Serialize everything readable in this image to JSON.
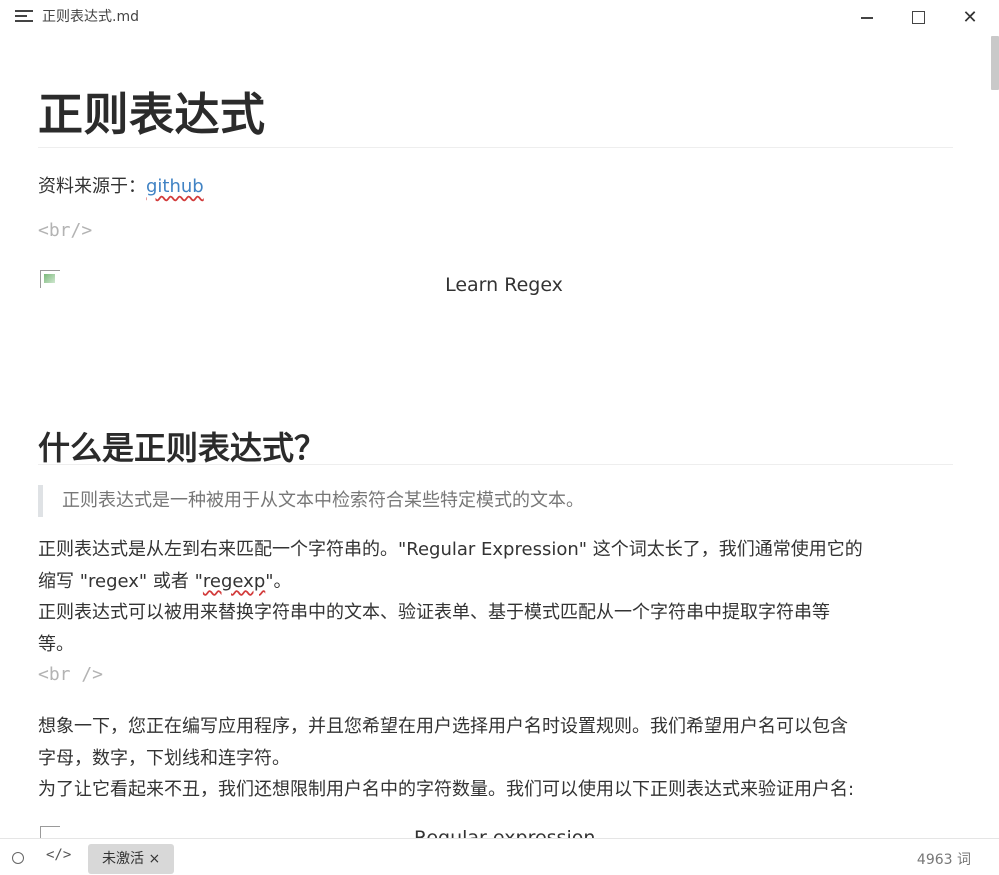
{
  "window": {
    "title": "正则表达式.md",
    "menu_icon": "hamburger-menu-icon",
    "minimize_icon": "minimize-icon",
    "maximize_icon": "maximize-icon",
    "close_glyph": "✕"
  },
  "document": {
    "h1": "正则表达式",
    "source_prefix": "资料来源于：",
    "source_link": "github",
    "br_code_1": "<br/>",
    "image_alt": "Learn Regex",
    "h2": "什么是正则表达式？",
    "blockquote": "正则表达式是一种被用于从文本中检索符合某些特定模式的文本。",
    "p1_line1": "正则表达式是从左到右来匹配一个字符串的。\"Regular Expression\" 这个词太长了，我们通常使用它的",
    "p1_line2_a": "缩写 \"regex\" 或者 \"",
    "p1_line2_spell": "regexp",
    "p1_line2_b": "\"。",
    "p1_line3": "正则表达式可以被用来替换字符串中的文本、验证表单、基于模式匹配从一个字符串中提取字符串等",
    "p1_line4": "等。",
    "br_code_2": "<br />",
    "p2_line1": "想象一下，您正在编写应用程序，并且您希望在用户选择用户名时设置规则。我们希望用户名可以包含",
    "p2_line2": "字母，数字，下划线和连字符。",
    "p2_line3": "为了让它看起来不丑，我们还想限制用户名中的字符数量。我们可以使用以下正则表达式来验证用户名:",
    "image2_alt_partial": "Regular expression"
  },
  "statusbar": {
    "sidebar_toggle_icon": "circle-icon",
    "source_mode_glyph": "</>",
    "badge_label": "未激活 ×",
    "word_count": "4963 词"
  }
}
